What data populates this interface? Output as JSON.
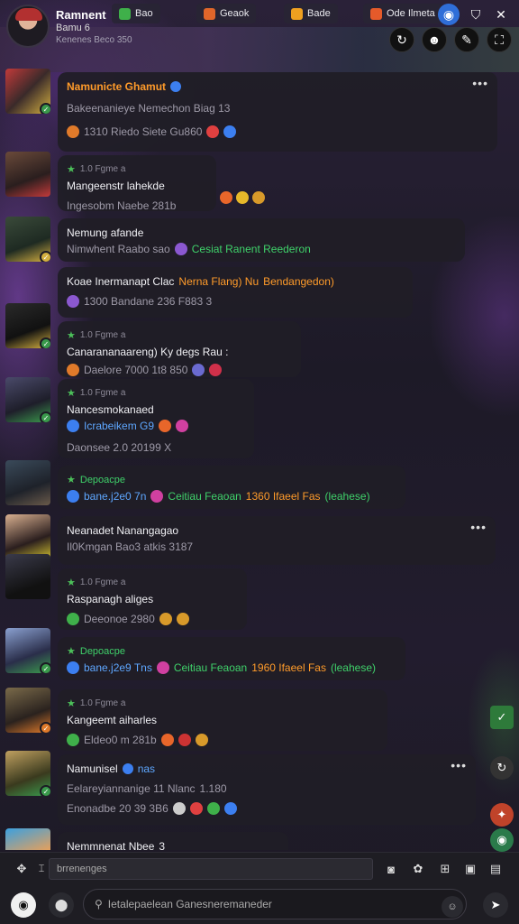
{
  "profile": {
    "name": "Ramnent",
    "subtitle": "Bamu 6",
    "status": "Kenenes Beco 350"
  },
  "top_tabs": [
    {
      "label": "Bao",
      "color": "#3fb04a"
    },
    {
      "label": "Geaok",
      "color": "#e0662a"
    },
    {
      "label": "Bade",
      "color": "#f0a020"
    },
    {
      "label": "Ode Ilmeta",
      "color": "#e55a2a"
    }
  ],
  "messages": [
    {
      "name": "Namunicte Ghamut",
      "text": "Bakeenanieye Nemechon Biag 13",
      "reactions": "1310  Riedo  Siete  Gu860",
      "emoji_colors": [
        "#e07a2a",
        "#3fb04a",
        "#c33",
        "#3c7ff0",
        "#e04040",
        "#3c7ff0"
      ]
    },
    {
      "meta": "1.0 Fgme a",
      "text": "Mangeenstr lahekde",
      "reactions": "Ingesobm Naebe  281b",
      "emoji_colors": [
        "#e8662a",
        "#e6b82a",
        "#d89a2a"
      ]
    },
    {
      "text": "Nemung afande",
      "reactions": "Nimwhent  Raabo sao",
      "highlight": "Cesiat Ranent Reederon",
      "emoji_colors": [
        "#e07a2a",
        "#8b58d0"
      ]
    },
    {
      "text": "Koae Inermanapt Clac",
      "text_orange": "Nerna Flang) Nu",
      "text_tail": "Bendangedon)",
      "reactions": "1300 Bandane  236 F883 3",
      "emoji_colors": [
        "#8b58d0",
        "#d89a2a"
      ]
    },
    {
      "meta": "1.0 Fgme a",
      "text": "Canarananaareng) Ky degs Rau :",
      "reactions": "Daelore  7000  1t8  850",
      "emoji_colors": [
        "#e07a2a",
        "#3c7ff0",
        "#3fb04a",
        "#e8662a",
        "#6a6ad0",
        "#d0304a"
      ]
    },
    {
      "meta": "1.0 Fgme a",
      "text": "Nancesmokanaed",
      "line2": "Icrabeikem  G9",
      "reactions": "Daonsee  2.0 20199 X",
      "emoji_colors": [
        "#3c7ff0",
        "#3fb04a",
        "#e8662a",
        "#cc3333",
        "#d040a0"
      ]
    },
    {
      "meta": "Depoacpe",
      "text": "bane.j2e0 7n",
      "highlight": "Ceitiau Feaoan",
      "tail": "1360 Ifaeel Fas",
      "tail2": "(leahese)",
      "emoji_colors": [
        "#3c7ff0",
        "#d040a0"
      ]
    },
    {
      "text": "Neanadet Nanangagao",
      "reactions": "Il0Kmgan Bao3 atkis 3187",
      "emoji_colors": []
    },
    {
      "meta": "1.0 Fgme a",
      "text": "Raspanagh aliges",
      "reactions": "Deeonoe  2980",
      "emoji_colors": [
        "#3fb04a",
        "#e04040",
        "#d89a2a",
        "#d89a2a",
        "#d89a2a"
      ]
    },
    {
      "meta": "Depoacpe",
      "text": "bane.j2e9 Tns",
      "highlight": "Ceitiau Feaoan",
      "tail": "1960 Ifaeel Fas",
      "tail2": "(leahese)",
      "emoji_colors": [
        "#3c7ff0",
        "#d040a0"
      ]
    },
    {
      "meta": "1.0 Fgme a",
      "text": "Kangeemt aiharles",
      "reactions": "Eldeo0  m  281b",
      "emoji_colors": [
        "#e04040",
        "#3fb04a",
        "#e8662a",
        "#cc3333",
        "#d89a2a"
      ]
    },
    {
      "name": "Namunisel",
      "name_tag": "nas",
      "text": "Eelareyiannanige 11 Nlanc",
      "num": "1.180",
      "reactions": "Enonadbe  20 39 3B6",
      "emoji_colors": [
        "#e07a2a",
        "#cccccc",
        "#e04040",
        "#3fb04a",
        "#3c7ff0"
      ]
    },
    {
      "text": "Nemmnenat Nbee",
      "tag": "3",
      "emoji_colors": []
    }
  ],
  "composer": {
    "input_value": "brrenenges",
    "search_placeholder": "Ietalepaelean Ganesneremaneder"
  }
}
